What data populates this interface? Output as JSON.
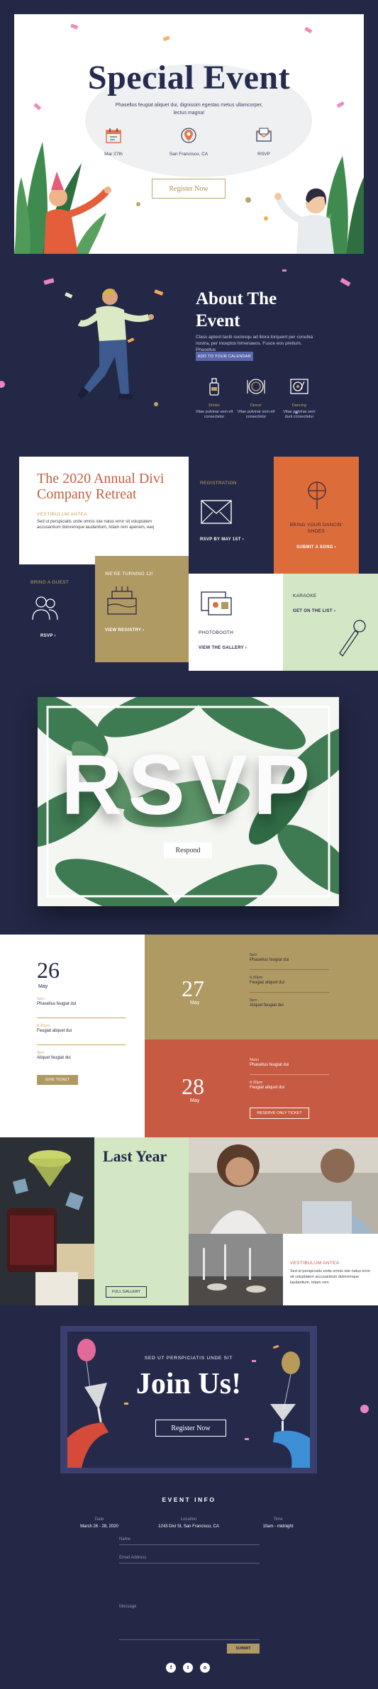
{
  "hero": {
    "title": "Special Event",
    "subtitle": "Phasellus feugiat aliquet dui, dignissim egestas metus ullamcorper, lectus magna!",
    "items": [
      {
        "icon": "calendar-icon",
        "label": "Mar 27th"
      },
      {
        "icon": "map-pin-icon",
        "label": "San Francisco, CA"
      },
      {
        "icon": "envelope-icon",
        "label": "RSVP"
      }
    ],
    "button": "Register Now"
  },
  "about": {
    "title_line1": "About The",
    "title_line2": "Event",
    "text": "Class aptent taciti sociosqu ad litora torquent per conubia nostra, per inceptos himenaeos. Fusce eos pretium. Phasellus",
    "button": "ADD TO YOUR CALENDAR",
    "items": [
      {
        "icon": "drinks-icon",
        "label": "Drinks",
        "text": "Vitae pulvinar sem elt consectetur"
      },
      {
        "icon": "dinner-icon",
        "label": "Dinner",
        "text": "Vitae pulvinar sem elt consectetur"
      },
      {
        "icon": "turntable-icon",
        "label": "Dancing",
        "text": "Vitae pulvinar sem dunt consectetur"
      }
    ]
  },
  "grid": {
    "retreat": {
      "title_line1": "The 2020 Annual Divi",
      "title_line2": "Company Retreat",
      "kicker": "VESTIBULUM ANTEA",
      "text": "Sed ut perspiciatis unde omnis iste natus error sit voluptatem accusantium doloremque laudantium, totam rem aperiam, eaq"
    },
    "registration": {
      "label": "REGISTRATION",
      "link": "RSVP BY MAY 1ST"
    },
    "dancing": {
      "label": "BRING YOUR DANCIN' SHOES",
      "link": "SUBMIT A SONG"
    },
    "guest": {
      "label": "BRING A GUEST",
      "link": "RSVP"
    },
    "turning": {
      "label": "WE'RE TURNING 12!",
      "link": "VIEW REGISTRY"
    },
    "photobooth": {
      "label": "PHOTOBOOTH",
      "link": "VIEW THE GALLERY"
    },
    "karaoke": {
      "label": "KARAOKE",
      "link": "GET ON THE LIST"
    }
  },
  "rsvp": {
    "word": "RSVP",
    "button": "Respond"
  },
  "schedule": {
    "day1": {
      "num": "26",
      "mon": "May",
      "items": [
        {
          "time": "5pm",
          "text": "Phasellus feugiat dui"
        },
        {
          "time": "6:30pm",
          "text": "Feugiat aliquet dui"
        },
        {
          "time": "8pm",
          "text": "Aliquet feugiat dui"
        }
      ],
      "button": "GIVE TICKET"
    },
    "day2": {
      "num": "27",
      "mon": "May",
      "items": [
        {
          "time": "5pm",
          "text": "Phasellus feugiat dui"
        },
        {
          "time": "6:30pm",
          "text": "Feugiat aliquet dui"
        },
        {
          "time": "8pm",
          "text": "Aliquet feugiat dui"
        }
      ]
    },
    "day3": {
      "num": "28",
      "mon": "May",
      "items": [
        {
          "time": "Noon",
          "text": "Phasellus feugiat dui"
        },
        {
          "time": "6:30pm",
          "text": "Feugiat aliquet dui"
        }
      ],
      "button": "RESERVE ONLY TICKET"
    }
  },
  "gallery": {
    "title": "Last Year",
    "button": "FULL GALLERY",
    "kicker": "VESTIBULUM ANTEA",
    "text": "Sed ut perspiciatis unde omnis iste natus error sit voluptatem accusantium doloremque laudantium, totam rem"
  },
  "join": {
    "kicker": "SED UT PERSPICIATIS UNDE SIT",
    "title": "Join Us!",
    "button": "Register Now"
  },
  "footer": {
    "title": "EVENT INFO",
    "cols": [
      {
        "k": "Date",
        "v": "March 26 - 28, 2020"
      },
      {
        "k": "Location",
        "v": "1243 Divi St, San Francisco, CA"
      },
      {
        "k": "Time",
        "v": "10am - midnight"
      }
    ],
    "name_placeholder": "Name",
    "email_placeholder": "Email Address",
    "message_placeholder": "Message",
    "submit": "SUBMIT",
    "socials": [
      "f",
      "t",
      "o"
    ]
  },
  "colors": {
    "navy": "#232846",
    "gold": "#b09a64",
    "orange": "#dc6c3a",
    "red": "#c65a42",
    "mint": "#d4e7c5",
    "leaf": "#3e7a52"
  }
}
